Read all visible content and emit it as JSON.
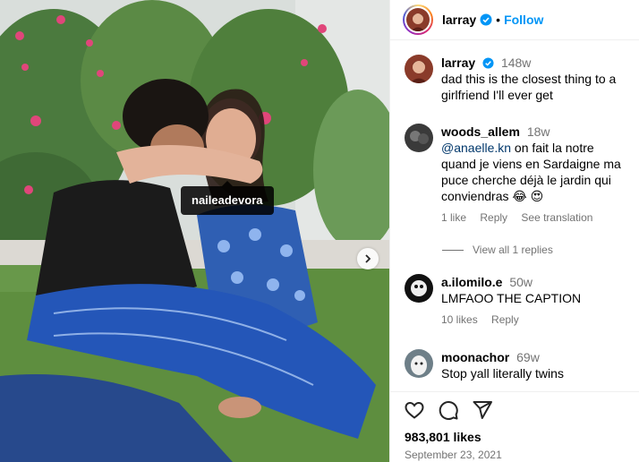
{
  "post": {
    "tagged_user": "naileadevora",
    "likes": "983,801 likes",
    "date": "September 23, 2021"
  },
  "header": {
    "username": "larray",
    "separator": "•",
    "follow_label": "Follow"
  },
  "caption": {
    "username": "larray",
    "time": "148w",
    "text": "dad this is the closest thing to a girlfriend I'll ever get"
  },
  "comments": [
    {
      "username": "woods_allem",
      "time": "18w",
      "mention": "@anaelle.kn",
      "text": " on fait la notre quand je viens en Sardaigne ma puce cherche déjà le jardin qui conviendras 😂 😍",
      "likes": "1 like",
      "reply": "Reply",
      "translate": "See translation"
    },
    {
      "username": "a.ilomilo.e",
      "time": "50w",
      "text": "LMFAOO THE CAPTION",
      "likes": "10 likes",
      "reply": "Reply"
    },
    {
      "username": "moonachor",
      "time": "69w",
      "text": "Stop yall literally twins"
    }
  ],
  "view_replies": "View all 1 replies",
  "icons": {
    "like": "heart-icon",
    "comment": "comment-icon",
    "share": "share-icon",
    "verified": "verified-badge-icon",
    "next": "chevron-right-icon"
  },
  "colors": {
    "link": "#0095f6",
    "verified": "#0095f6",
    "secondary_text": "#737373",
    "mention": "#00376b"
  }
}
